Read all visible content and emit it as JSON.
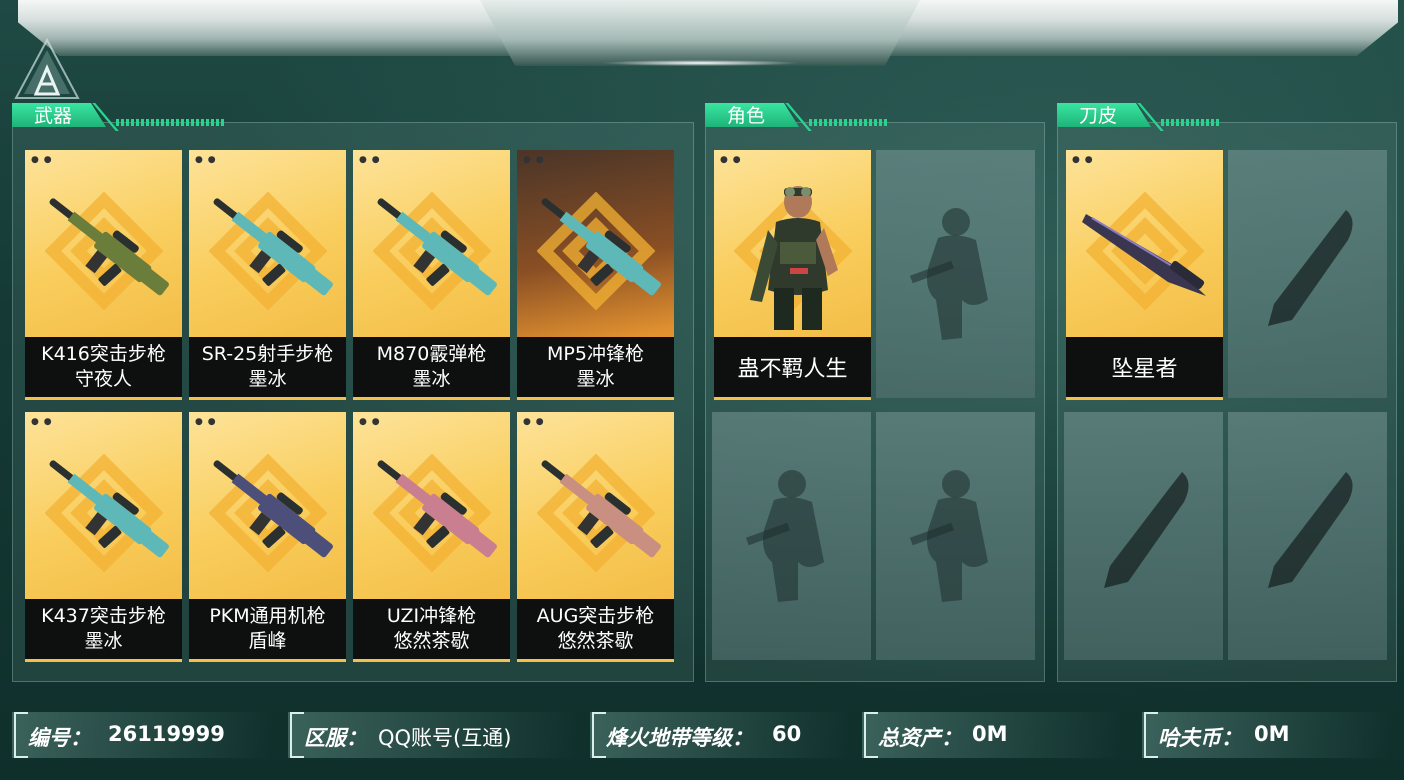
{
  "sections": {
    "weapons": {
      "title": "武器"
    },
    "roles": {
      "title": "角色"
    },
    "knife_skins": {
      "title": "刀皮"
    }
  },
  "weapons": [
    {
      "name": "K416突击步枪",
      "skin": "守夜人",
      "bg": "gold",
      "color": "#6a7d3a"
    },
    {
      "name": "SR-25射手步枪",
      "skin": "墨冰",
      "bg": "gold",
      "color": "#5fb8b8"
    },
    {
      "name": "M870霰弹枪",
      "skin": "墨冰",
      "bg": "gold",
      "color": "#5fb8b8"
    },
    {
      "name": "MP5冲锋枪",
      "skin": "墨冰",
      "bg": "brown",
      "color": "#5fb8b8"
    },
    {
      "name": "K437突击步枪",
      "skin": "墨冰",
      "bg": "gold",
      "color": "#5fb8b8"
    },
    {
      "name": "PKM通用机枪",
      "skin": "盾峰",
      "bg": "gold",
      "color": "#4b4f7a"
    },
    {
      "name": "UZI冲锋枪",
      "skin": "悠然茶歇",
      "bg": "gold",
      "color": "#c97f8f"
    },
    {
      "name": "AUG突击步枪",
      "skin": "悠然茶歇",
      "bg": "gold",
      "color": "#c98f80"
    }
  ],
  "roles": [
    {
      "name": "蛊不羁人生",
      "icon": "operator-portrait"
    },
    {
      "name": "",
      "icon": "soldier-silhouette-icon"
    },
    {
      "name": "",
      "icon": "soldier-silhouette-icon"
    },
    {
      "name": "",
      "icon": "soldier-silhouette-icon"
    }
  ],
  "knives": [
    {
      "name": "坠星者",
      "icon": "knife-icon"
    },
    {
      "name": "",
      "icon": "knife-silhouette-icon"
    },
    {
      "name": "",
      "icon": "knife-silhouette-icon"
    },
    {
      "name": "",
      "icon": "knife-silhouette-icon"
    }
  ],
  "stats": [
    {
      "key": "编号：",
      "value": "26119999"
    },
    {
      "key": "区服：",
      "value": "QQ账号(互通)"
    },
    {
      "key": "烽火地带等级：",
      "value": "60"
    },
    {
      "key": "总资产：",
      "value": "0M"
    },
    {
      "key": "哈夫币：",
      "value": "0M"
    }
  ],
  "colors": {
    "accent": "#27d58f",
    "card_gold": "#f9cd5c",
    "label_bg": "#0e1010"
  }
}
